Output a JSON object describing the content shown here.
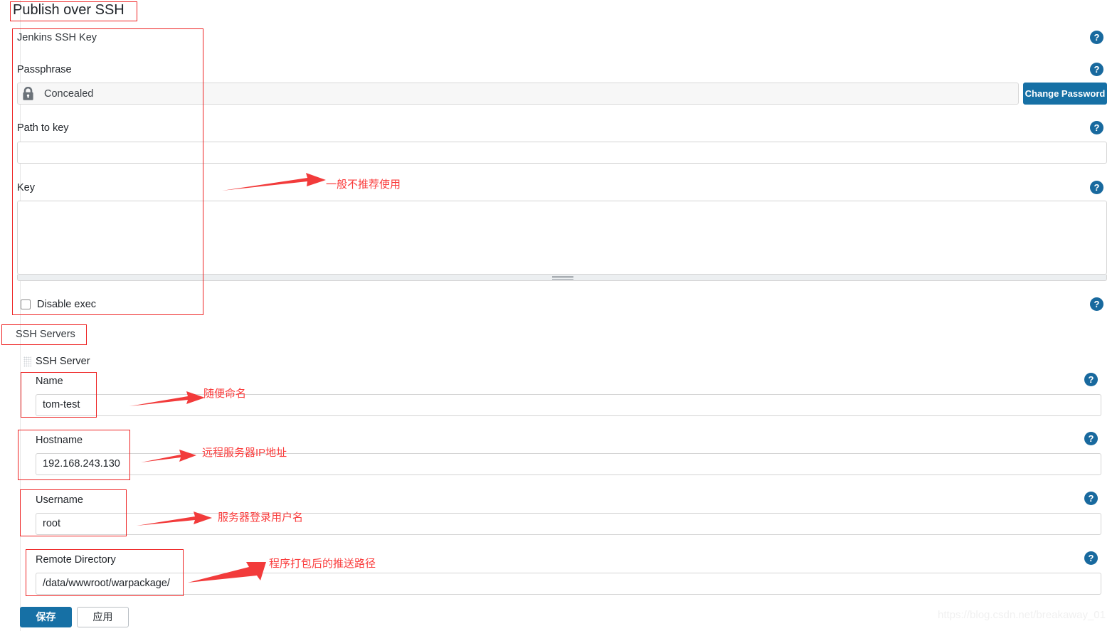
{
  "page": {
    "title": "Publish over SSH",
    "watermark": "https://blog.csdn.net/breakaway_01"
  },
  "jenkins_ssh_key": {
    "heading": "Jenkins SSH Key",
    "passphrase": {
      "label": "Passphrase",
      "value": "Concealed",
      "lock_icon": "lock-icon",
      "change_password_label": "Change Password"
    },
    "path_to_key": {
      "label": "Path to key",
      "value": "",
      "placeholder": ""
    },
    "key": {
      "label": "Key",
      "value": ""
    },
    "disable_exec": {
      "label": "Disable exec",
      "checked": false
    }
  },
  "ssh_servers": {
    "heading": "SSH Servers",
    "server_entry_label": "SSH Server",
    "drag_handle_icon": "drag-handle-icon",
    "fields": [
      {
        "label": "Name",
        "value": "tom-test"
      },
      {
        "label": "Hostname",
        "value": "192.168.243.130"
      },
      {
        "label": "Username",
        "value": "root"
      },
      {
        "label": "Remote Directory",
        "value": "/data/wwwroot/warpackage/"
      }
    ]
  },
  "footer": {
    "save_label": "保存",
    "apply_label": "应用"
  },
  "help_icons": {
    "glyph": "?",
    "name": "help-icon",
    "color": "#18699e"
  },
  "annotations": {
    "color": "#fa3c3c",
    "notes": [
      {
        "text": "一般不推荐使用",
        "name": "annotation-key-note"
      },
      {
        "text": "随便命名",
        "name": "annotation-name-note"
      },
      {
        "text": "远程服务器IP地址",
        "name": "annotation-hostname-note"
      },
      {
        "text": "服务器登录用户名",
        "name": "annotation-username-note"
      },
      {
        "text": "程序打包后的推送路径",
        "name": "annotation-remote-dir-note"
      }
    ]
  }
}
